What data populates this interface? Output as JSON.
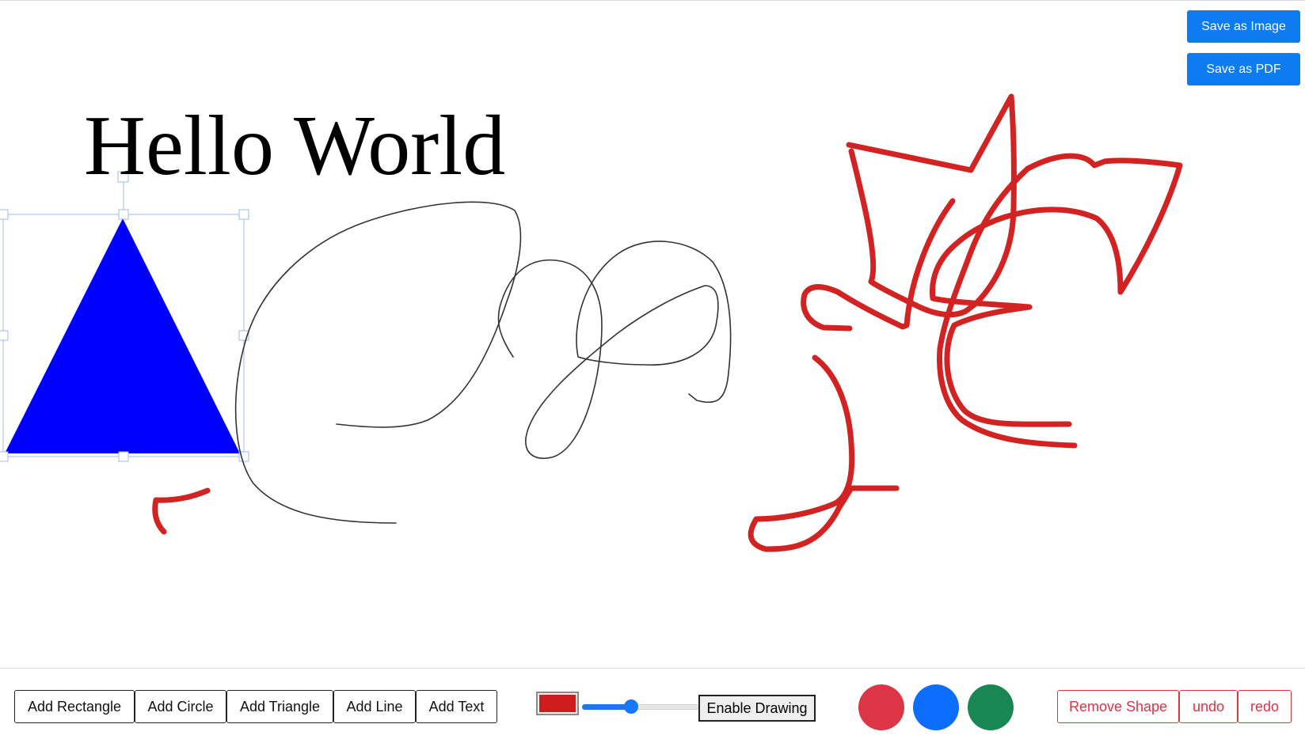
{
  "canvas": {
    "text_object": "Hello World",
    "triangle_color": "#0000ff",
    "selection_color": "#9fb7f5",
    "pen_color_red": "#d32222",
    "pen_color_black": "#333333"
  },
  "save_buttons": {
    "image_label": "Save as Image",
    "pdf_label": "Save as PDF",
    "color": "#0d7cf2"
  },
  "toolbar": {
    "add_rectangle": "Add Rectangle",
    "add_circle": "Add Circle",
    "add_triangle": "Add Triangle",
    "add_line": "Add Line",
    "add_text": "Add Text",
    "color_picker_value": "#cc1c1c",
    "brush_width_level": 0.42,
    "enable_drawing": "Enable Drawing",
    "color_presets": [
      {
        "name": "red",
        "hex": "#dc3545"
      },
      {
        "name": "blue",
        "hex": "#0d6efd"
      },
      {
        "name": "green",
        "hex": "#198754"
      }
    ],
    "remove_shape": "Remove Shape",
    "undo": "undo",
    "redo": "redo"
  }
}
